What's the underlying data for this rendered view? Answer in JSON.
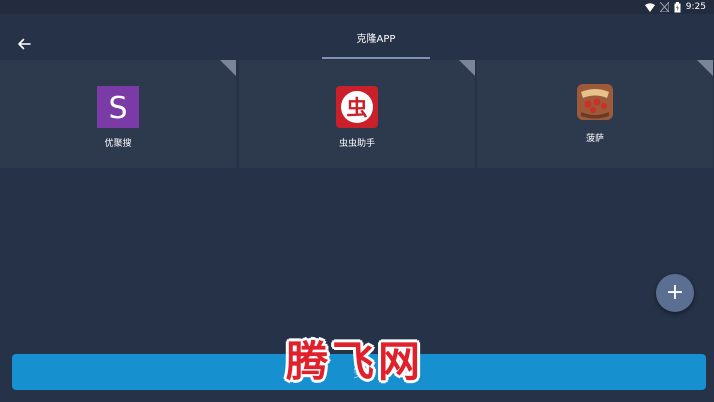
{
  "status_bar": {
    "time": "9:25",
    "icons": [
      "wifi-icon",
      "signal-icon",
      "battery-icon"
    ]
  },
  "header": {
    "title": "克隆APP",
    "back_icon": "arrow-left-icon"
  },
  "apps": [
    {
      "label": "优聚搜",
      "icon": "youjusou-icon",
      "icon_letter": "S",
      "color": "#7b3ba6"
    },
    {
      "label": "虫虫助手",
      "icon": "chongchong-icon",
      "icon_letter": "虫",
      "color": "#c9202a"
    },
    {
      "label": "菠萨",
      "icon": "pizza-icon",
      "icon_letter": "",
      "color": "#9c5a3a"
    }
  ],
  "fab": {
    "icon": "plus-icon",
    "label": "+"
  },
  "install_button": {
    "label": "安"
  },
  "watermark": {
    "text": "腾飞网"
  },
  "colors": {
    "background": "#263247",
    "card": "#2d3a4d",
    "accent": "#1790d0",
    "fab": "#5b6f92"
  }
}
